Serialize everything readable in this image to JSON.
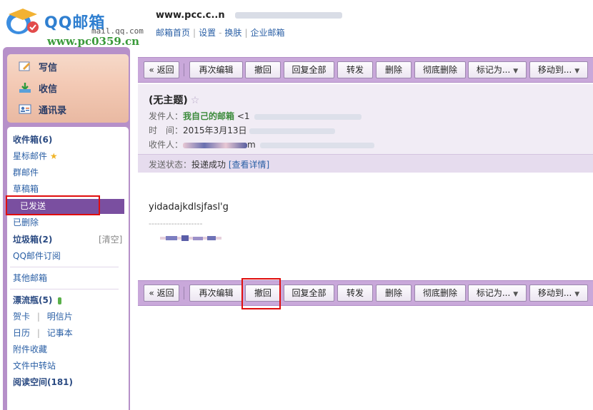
{
  "header": {
    "logo_text": "QQ邮箱",
    "logo_sub": "mail.qq.com",
    "watermark": "www.pc0359.cn",
    "account_name": "www.pcc.c..n",
    "links": [
      "邮箱首页",
      "设置",
      "换肤",
      "企业邮箱"
    ]
  },
  "sidebar": {
    "quick": [
      {
        "label": "写信",
        "icon": "pencil-icon"
      },
      {
        "label": "收信",
        "icon": "inbox-download-icon"
      },
      {
        "label": "通讯录",
        "icon": "contacts-icon"
      }
    ],
    "folders": {
      "inbox": "收件箱(6)",
      "starred": "星标邮件",
      "group": "群邮件",
      "drafts": "草稿箱",
      "sent": "已发送",
      "deleted": "已删除",
      "spam": "垃圾箱(2)",
      "spam_clear": "[清空]",
      "subscriptions": "QQ邮件订阅",
      "other": "其他邮箱",
      "drift_bottle": "漂流瓶(5)",
      "cards": "贺卡",
      "postcards": "明信片",
      "calendar": "日历",
      "notes": "记事本",
      "attachments": "附件收藏",
      "file_transfer": "文件中转站",
      "reading": "阅读空间(181)"
    }
  },
  "toolbar": {
    "back": "« 返回",
    "edit_again": "再次编辑",
    "recall": "撤回",
    "reply_all": "回复全部",
    "forward": "转发",
    "delete": "删除",
    "delete_forever": "彻底删除",
    "mark_as": "标记为...",
    "move_to": "移动到..."
  },
  "mail": {
    "subject": "(无主题)",
    "star": "☆",
    "from_label": "发件人：",
    "from_name": "我自己的邮箱",
    "from_rest": "<1",
    "time_label": "时　间：",
    "time_value": "2015年3月13日",
    "to_label": "收件人：",
    "to_rest": "m",
    "status_label": "发送状态：",
    "status_value": "投递成功",
    "status_link": "[查看详情]",
    "body": "yidadajkdlsjfasl'g",
    "dashes": "-------------------"
  },
  "colors": {
    "accent_purple": "#7a4fa0",
    "sidebar_bg": "#b690c9",
    "toolbar_bg": "#c9a8da",
    "highlight_red": "#e00d0d",
    "link_blue": "#2a5fa5"
  }
}
